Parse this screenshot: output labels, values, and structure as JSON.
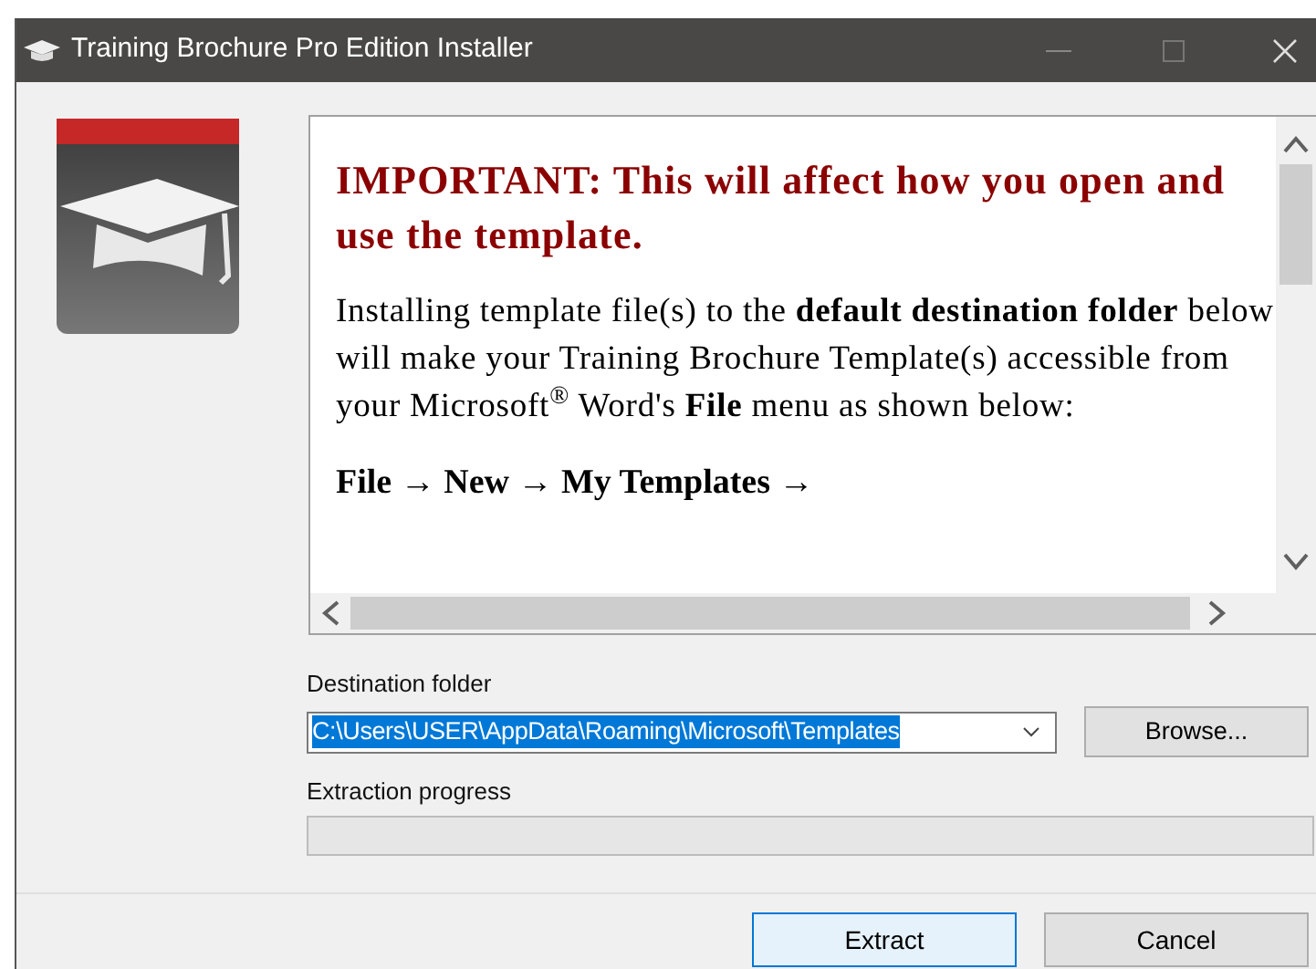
{
  "window": {
    "title": "Training Brochure Pro Edition Installer"
  },
  "notice": {
    "heading": "IMPORTANT: This will affect how you open and use the template.",
    "paragraph": "Installing template file(s) to the **default destination folder** below will make your Training Brochure Template(s) accessible from your Microsoft$^{®}$ Word's **File** menu as shown below:",
    "path": "File → New → My Templates →"
  },
  "destination": {
    "label": "Destination folder",
    "value": "C:\\Users\\USER\\AppData\\Roaming\\Microsoft\\Templates",
    "text_selected": true,
    "browse": "Browse..."
  },
  "progress": {
    "label": "Extraction progress",
    "level": 0
  },
  "buttons": [
    {
      "label": "Extract",
      "kind": "default"
    },
    {
      "label": "Cancel",
      "kind": "normal"
    }
  ]
}
